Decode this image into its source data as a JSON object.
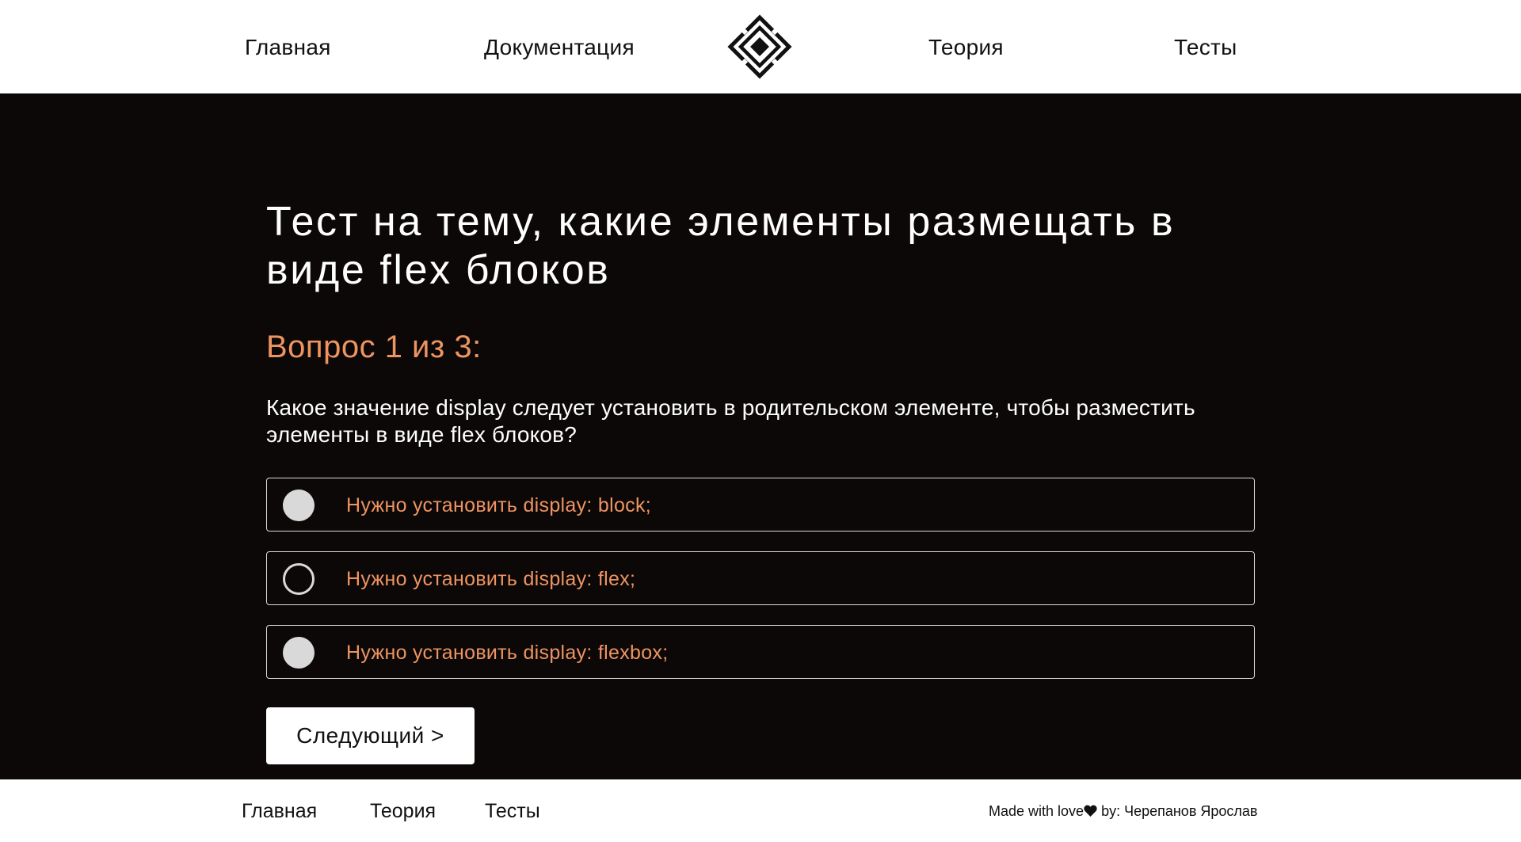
{
  "header": {
    "nav_home": "Главная",
    "nav_docs": "Документация",
    "nav_theory": "Теория",
    "nav_tests": "Тесты",
    "logo_icon": "diamond-logo-icon"
  },
  "quiz": {
    "title": "Тест на тему, какие элементы размещать в виде flex блоков",
    "question_counter": "Вопрос 1 из 3:",
    "question": "Какое значение display следует установить в родительском элементе, чтобы разместить элементы в виде flex блоков?",
    "options": [
      {
        "label": "Нужно установить display: block;",
        "radio_style": "filled"
      },
      {
        "label": "Нужно установить display: flex;",
        "radio_style": "outlined"
      },
      {
        "label": "Нужно установить display: flexbox;",
        "radio_style": "filled"
      }
    ],
    "next_button": "Следующий >"
  },
  "footer": {
    "nav_home": "Главная",
    "nav_theory": "Теория",
    "nav_tests": "Тесты",
    "credit_prefix": "Made with love",
    "credit_suffix": " by: Черепанов Ярослав",
    "heart_icon": "heart-icon"
  },
  "colors": {
    "accent": "#ee9461",
    "main_background": "#0c0808",
    "option_border": "#d9d9d9"
  }
}
